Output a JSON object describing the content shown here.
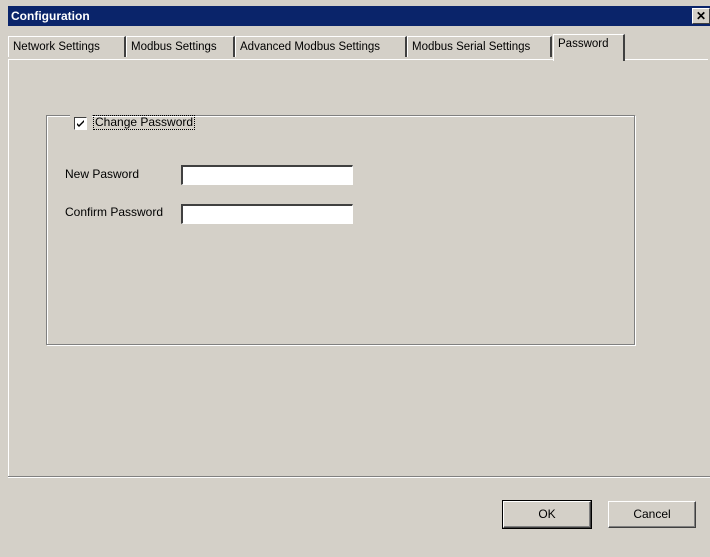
{
  "window": {
    "title": "Configuration",
    "close_glyph": "✕"
  },
  "tabs": [
    {
      "label": "Network Settings",
      "active": false
    },
    {
      "label": "Modbus Settings",
      "active": false
    },
    {
      "label": "Advanced Modbus Settings",
      "active": false
    },
    {
      "label": "Modbus Serial Settings",
      "active": false
    },
    {
      "label": "Password",
      "active": true
    }
  ],
  "password_group": {
    "checkbox_label": "Change Password",
    "checked": true,
    "new_password_label": "New Pasword",
    "new_password_value": "",
    "confirm_password_label": "Confirm Password",
    "confirm_password_value": ""
  },
  "buttons": {
    "ok_label": "OK",
    "cancel_label": "Cancel"
  }
}
